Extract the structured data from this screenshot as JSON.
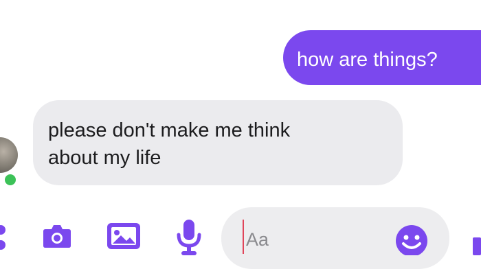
{
  "messages": [
    {
      "direction": "outgoing",
      "text": "how are things?"
    },
    {
      "direction": "incoming",
      "lines": [
        "please don't make me think",
        "about my life"
      ]
    }
  ],
  "contact": {
    "online": true,
    "presence_color": "#3cc258"
  },
  "composer": {
    "placeholder": "Aa",
    "icons": [
      "more-icon",
      "camera-icon",
      "image-icon",
      "microphone-icon",
      "emoji-icon",
      "like-icon"
    ]
  },
  "colors": {
    "accent": "#7b48ee",
    "incoming_bubble": "#ebebee",
    "composer_pill": "#ededef"
  }
}
